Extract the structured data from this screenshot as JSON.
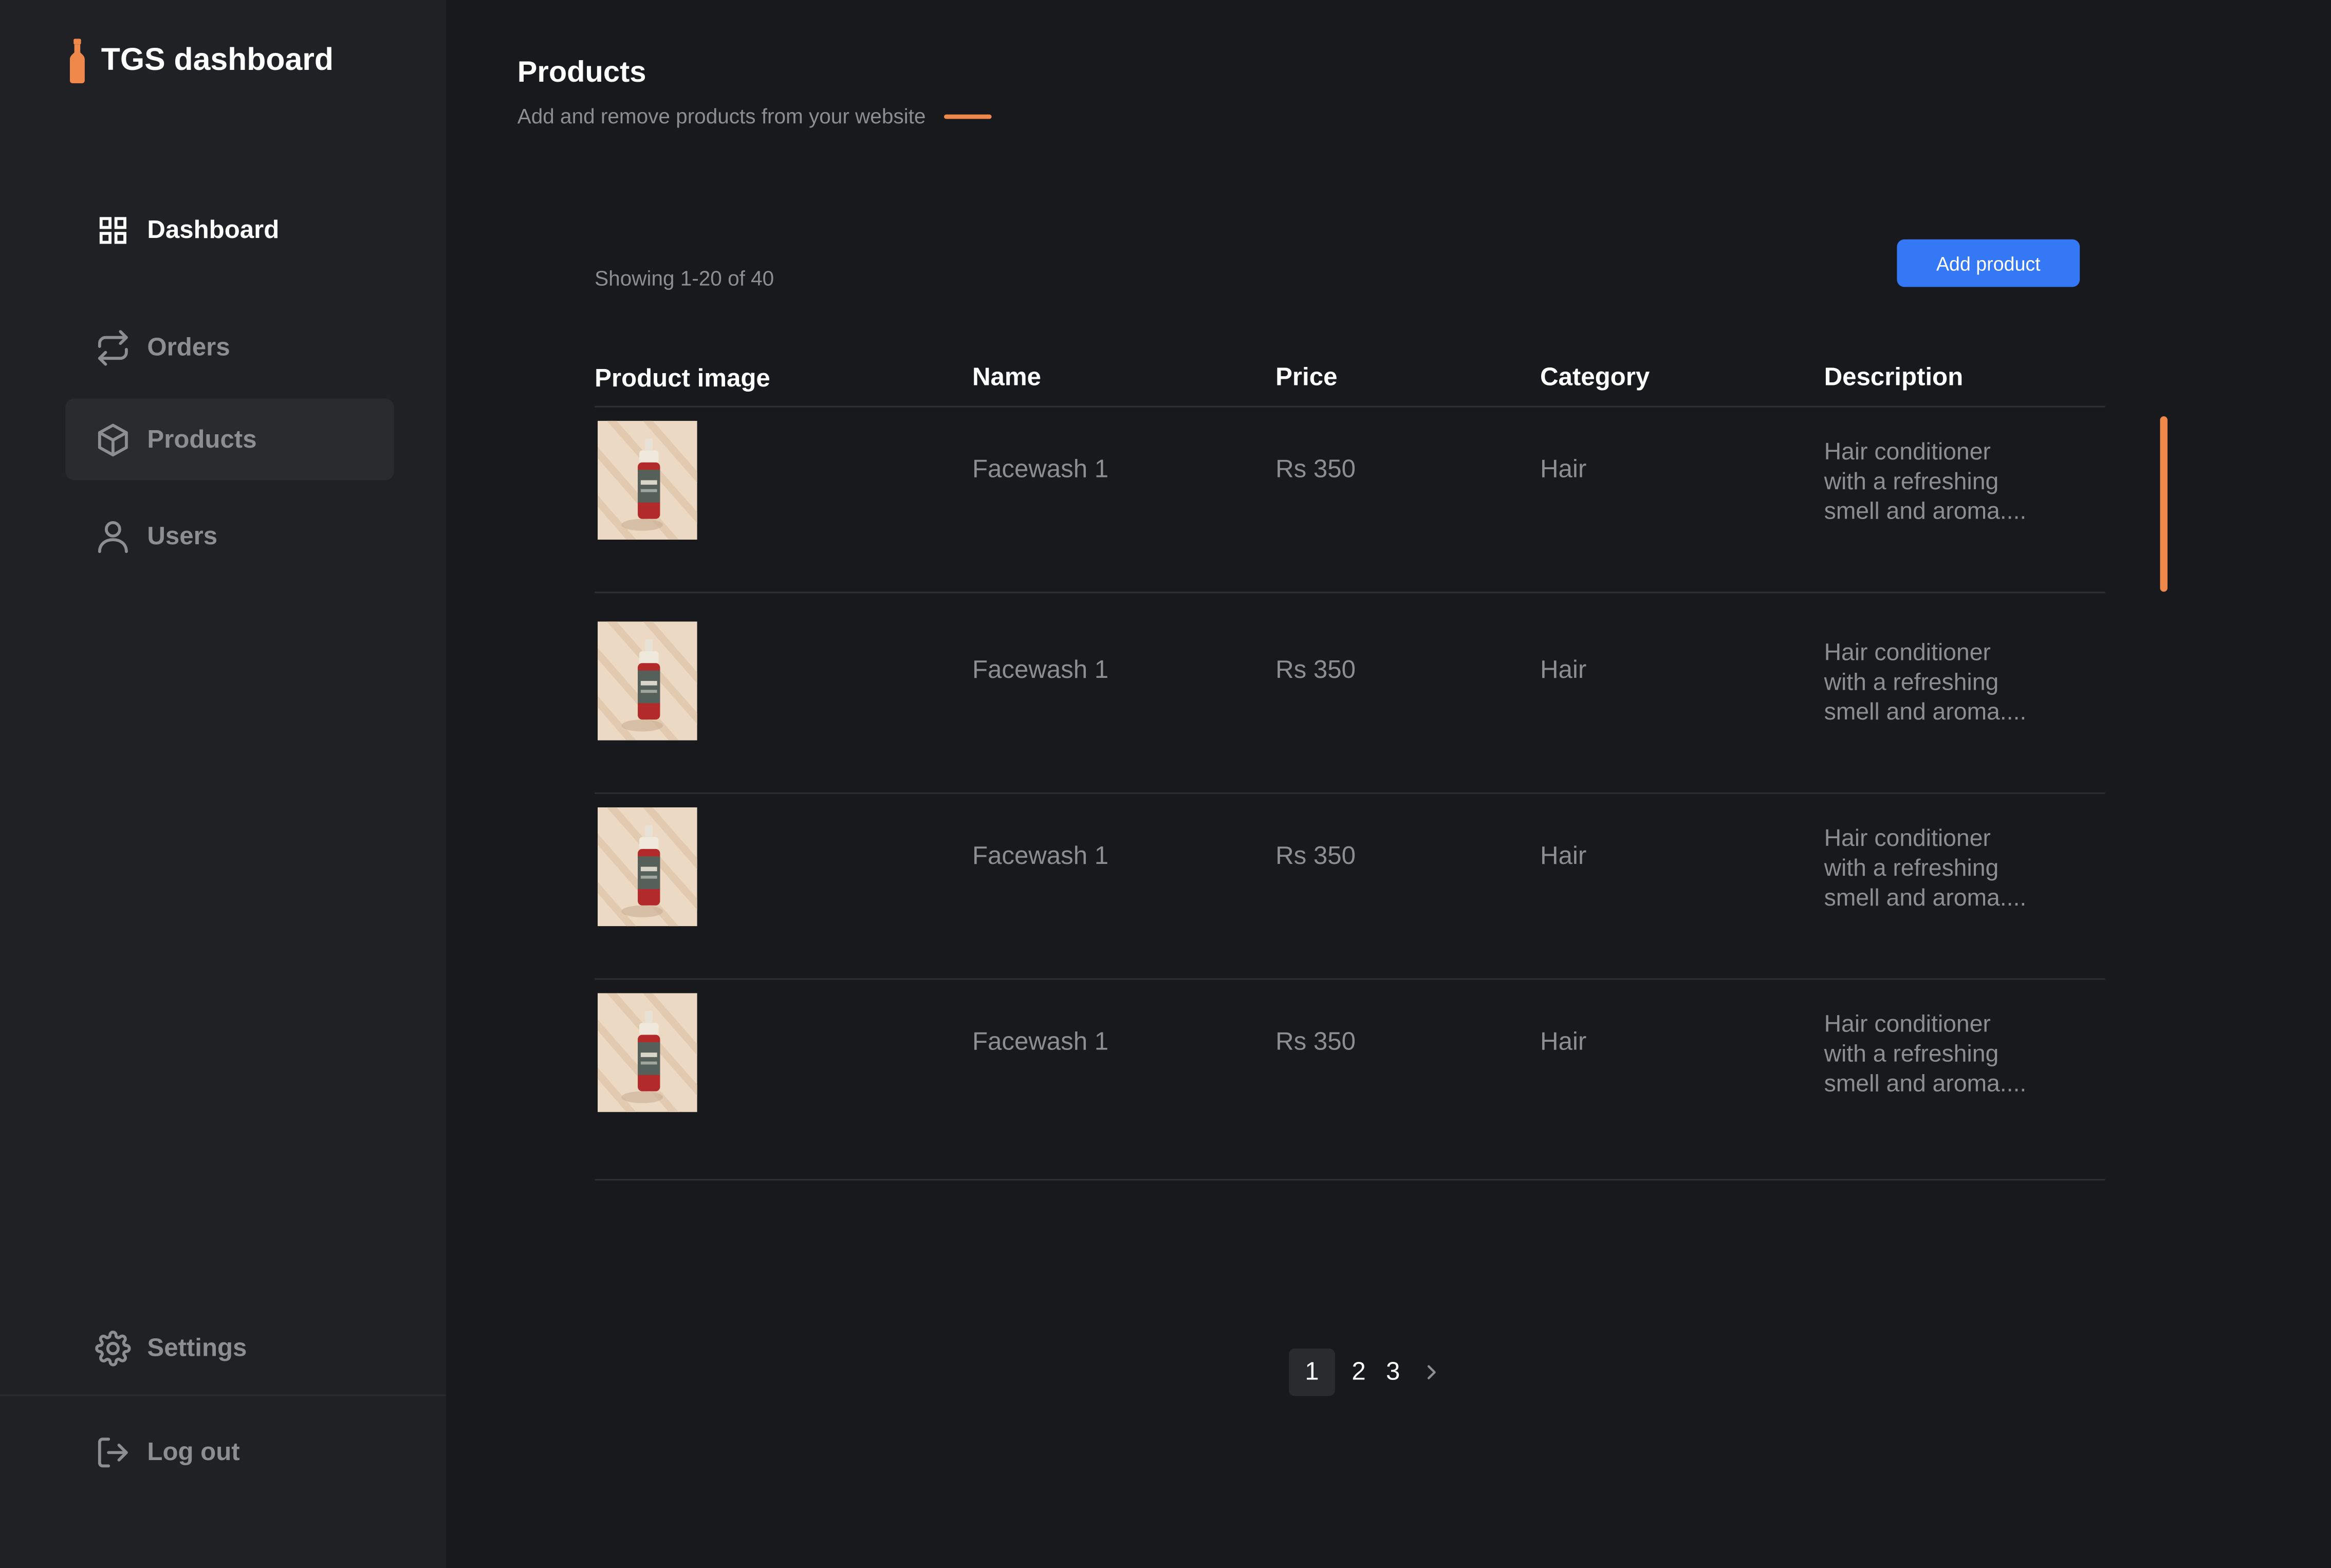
{
  "brand": {
    "title": "TGS dashboard"
  },
  "colors": {
    "accent": "#f0884b",
    "primary_button": "#3478f6",
    "background": "#18191c",
    "sidebar": "#202124"
  },
  "sidebar": {
    "items": [
      {
        "label": "Dashboard",
        "icon": "grid-icon"
      },
      {
        "label": "Orders",
        "icon": "repeat-arrows-icon"
      },
      {
        "label": "Products",
        "icon": "box-icon"
      },
      {
        "label": "Users",
        "icon": "user-icon"
      }
    ],
    "settings": {
      "label": "Settings",
      "icon": "gear-icon"
    },
    "logout": {
      "label": "Log out",
      "icon": "logout-icon"
    }
  },
  "page": {
    "title": "Products",
    "subtitle": "Add and remove products from your website"
  },
  "table": {
    "showing": "Showing 1-20 of 40",
    "add_button": "Add product",
    "columns": [
      "Product image",
      "Name",
      "Price",
      "Category",
      "Description"
    ],
    "rows": [
      {
        "name": "Facewash 1",
        "price": "Rs 350",
        "category": "Hair",
        "description": [
          "Hair conditioner",
          "with a refreshing",
          "smell and aroma...."
        ]
      },
      {
        "name": "Facewash 1",
        "price": "Rs 350",
        "category": "Hair",
        "description": [
          "Hair conditioner",
          "with a refreshing",
          "smell and aroma...."
        ]
      },
      {
        "name": "Facewash 1",
        "price": "Rs 350",
        "category": "Hair",
        "description": [
          "Hair conditioner",
          "with a refreshing",
          "smell and aroma...."
        ]
      },
      {
        "name": "Facewash 1",
        "price": "Rs 350",
        "category": "Hair",
        "description": [
          "Hair conditioner",
          "with a refreshing",
          "smell and aroma...."
        ]
      }
    ]
  },
  "pagination": {
    "pages": [
      "1",
      "2",
      "3"
    ],
    "current": "1",
    "next_icon": "chevron-right-icon"
  }
}
